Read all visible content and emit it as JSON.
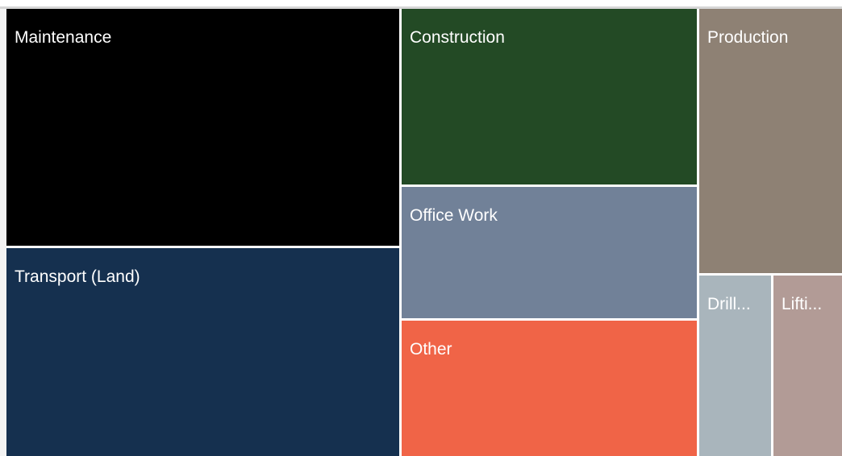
{
  "chart_data": {
    "type": "treemap",
    "title": "",
    "items": [
      {
        "label": "Maintenance",
        "display_label": "Maintenance",
        "value": 22.7,
        "color": "#000000"
      },
      {
        "label": "Transport (Land)",
        "display_label": "Transport (Land)",
        "value": 19.4,
        "color": "#15304f"
      },
      {
        "label": "Construction",
        "display_label": "Construction",
        "value": 14.1,
        "color": "#234a25"
      },
      {
        "label": "Office Work",
        "display_label": "Office Work",
        "value": 10.6,
        "color": "#718198"
      },
      {
        "label": "Other",
        "display_label": "Other",
        "value": 10.1,
        "color": "#f06447"
      },
      {
        "label": "Production",
        "display_label": "Production",
        "value": 11.6,
        "color": "#8e8174"
      },
      {
        "label": "Drill...",
        "display_label": "Drill...",
        "value": 5.2,
        "color": "#a9b5bc"
      },
      {
        "label": "Lifti...",
        "display_label": "Lifti...",
        "value": 6.3,
        "color": "#b29b96"
      }
    ]
  }
}
